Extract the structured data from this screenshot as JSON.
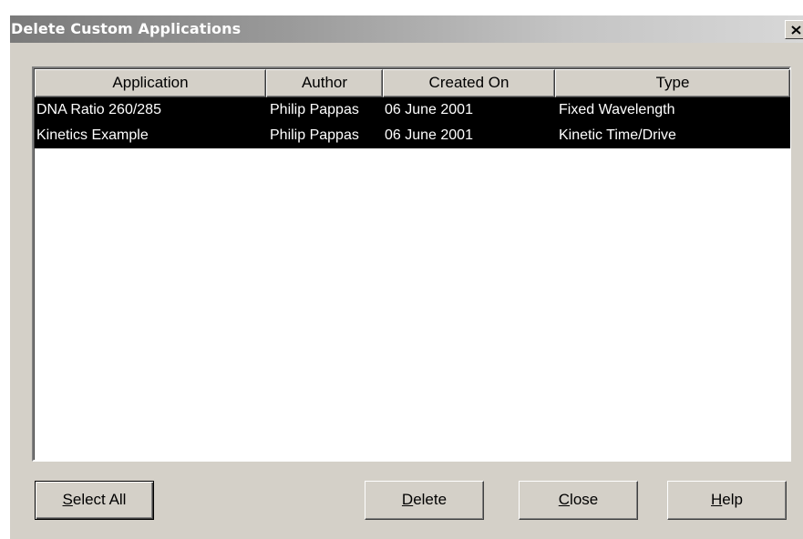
{
  "dialog": {
    "title": "Delete Custom Applications",
    "close_icon": "close-x-icon"
  },
  "table": {
    "columns": [
      "Application",
      "Author",
      "Created On",
      "Type"
    ],
    "rows": [
      {
        "application": "DNA Ratio 260/285",
        "author": "Philip Pappas",
        "created_on": "06 June 2001",
        "type": "Fixed Wavelength",
        "selected": true
      },
      {
        "application": "Kinetics Example",
        "author": "Philip Pappas",
        "created_on": "06 June 2001",
        "type": "Kinetic Time/Drive",
        "selected": true
      }
    ]
  },
  "buttons": {
    "select_all": {
      "mnemonic": "S",
      "rest": "elect All"
    },
    "delete": {
      "mnemonic": "D",
      "rest": "elete"
    },
    "close": {
      "mnemonic": "C",
      "rest": "lose"
    },
    "help": {
      "mnemonic": "H",
      "rest": "elp"
    }
  },
  "colors": {
    "face": "#d4d0c8",
    "selection": "#000000",
    "selection_text": "#ffffff"
  }
}
